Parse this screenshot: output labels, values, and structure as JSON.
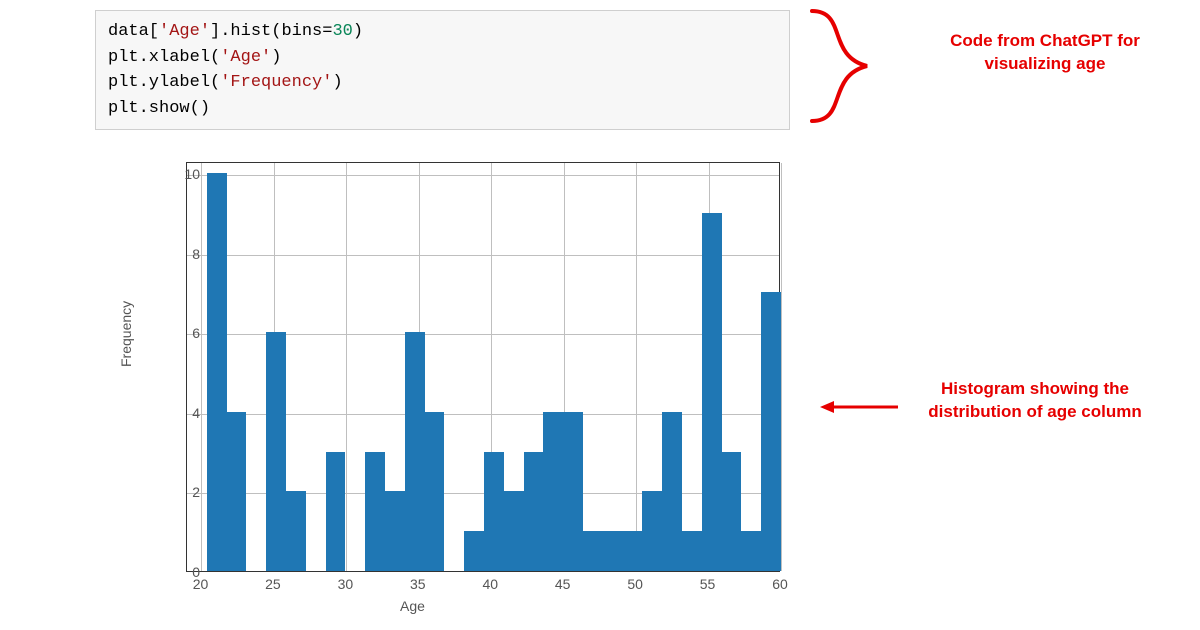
{
  "code": {
    "l1a": "data[",
    "l1b": "'Age'",
    "l1c": "].hist(bins=",
    "l1d": "30",
    "l1e": ")",
    "l2a": "plt.xlabel(",
    "l2b": "'Age'",
    "l2c": ")",
    "l3a": "plt.ylabel(",
    "l3b": "'Frequency'",
    "l3c": ")",
    "l4": "plt.show()"
  },
  "annot": {
    "top": "Code from ChatGPT for visualizing age",
    "mid": "Histogram showing the distribution of age column"
  },
  "chart_data": {
    "type": "bar",
    "title": "",
    "xlabel": "Age",
    "ylabel": "Frequency",
    "xlim": [
      19,
      60
    ],
    "ylim": [
      0,
      10.3
    ],
    "yticks": [
      0,
      2,
      4,
      6,
      8,
      10
    ],
    "xticks": [
      20,
      25,
      30,
      35,
      40,
      45,
      50,
      55,
      60
    ],
    "bin_edges": [
      19.0,
      20.37,
      21.73,
      23.1,
      24.47,
      25.83,
      27.2,
      28.57,
      29.93,
      31.3,
      32.67,
      34.03,
      35.4,
      36.77,
      38.13,
      39.5,
      40.87,
      42.23,
      43.6,
      44.97,
      46.33,
      47.7,
      49.07,
      50.43,
      51.8,
      53.17,
      54.53,
      55.9,
      57.27,
      58.63,
      60.0
    ],
    "values": [
      0,
      10,
      4,
      0,
      6,
      2,
      0,
      3,
      0,
      3,
      2,
      6,
      4,
      0,
      1,
      3,
      2,
      3,
      4,
      4,
      1,
      1,
      1,
      2,
      4,
      1,
      9,
      3,
      1,
      7
    ]
  }
}
